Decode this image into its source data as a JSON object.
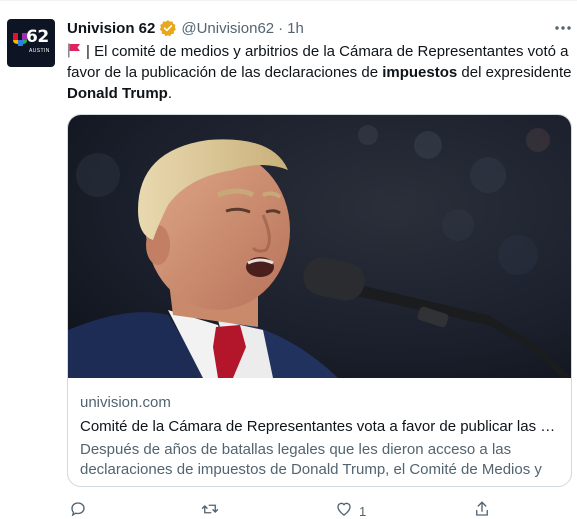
{
  "tweet": {
    "author_name": "Univision 62",
    "handle": "@Univision62",
    "separator": "·",
    "time": "1h",
    "avatar": {
      "number": "62",
      "city": "AUSTIN"
    },
    "text_part1": "| El comité de medios y arbitrios de la Cámara de Representantes votó a favor de la publicación de las declaraciones de ",
    "text_bold1": "impuestos",
    "text_part2": " del expresidente ",
    "text_bold2": "Donald Trump",
    "text_part3": ".",
    "flag_icon": "red-flag-icon",
    "verified_color": "#E8A81B"
  },
  "card": {
    "domain": "univision.com",
    "title": "Comité de la Cámara de Representantes vota a favor de publicar las declaraciones de impuestos de Donald Trump",
    "description": "Después de años de batallas legales que les dieron acceso a las declaraciones de impuestos de Donald Trump, el Comité de Medios y Arbitrios votó a favor de publicarlas."
  },
  "actions": {
    "reply_icon": "reply-icon",
    "retweet_icon": "retweet-icon",
    "like_icon": "heart-icon",
    "like_count": "1",
    "share_icon": "share-icon"
  },
  "colors": {
    "text": "#0f1419",
    "secondary": "#536471",
    "border": "#cfd9de"
  }
}
